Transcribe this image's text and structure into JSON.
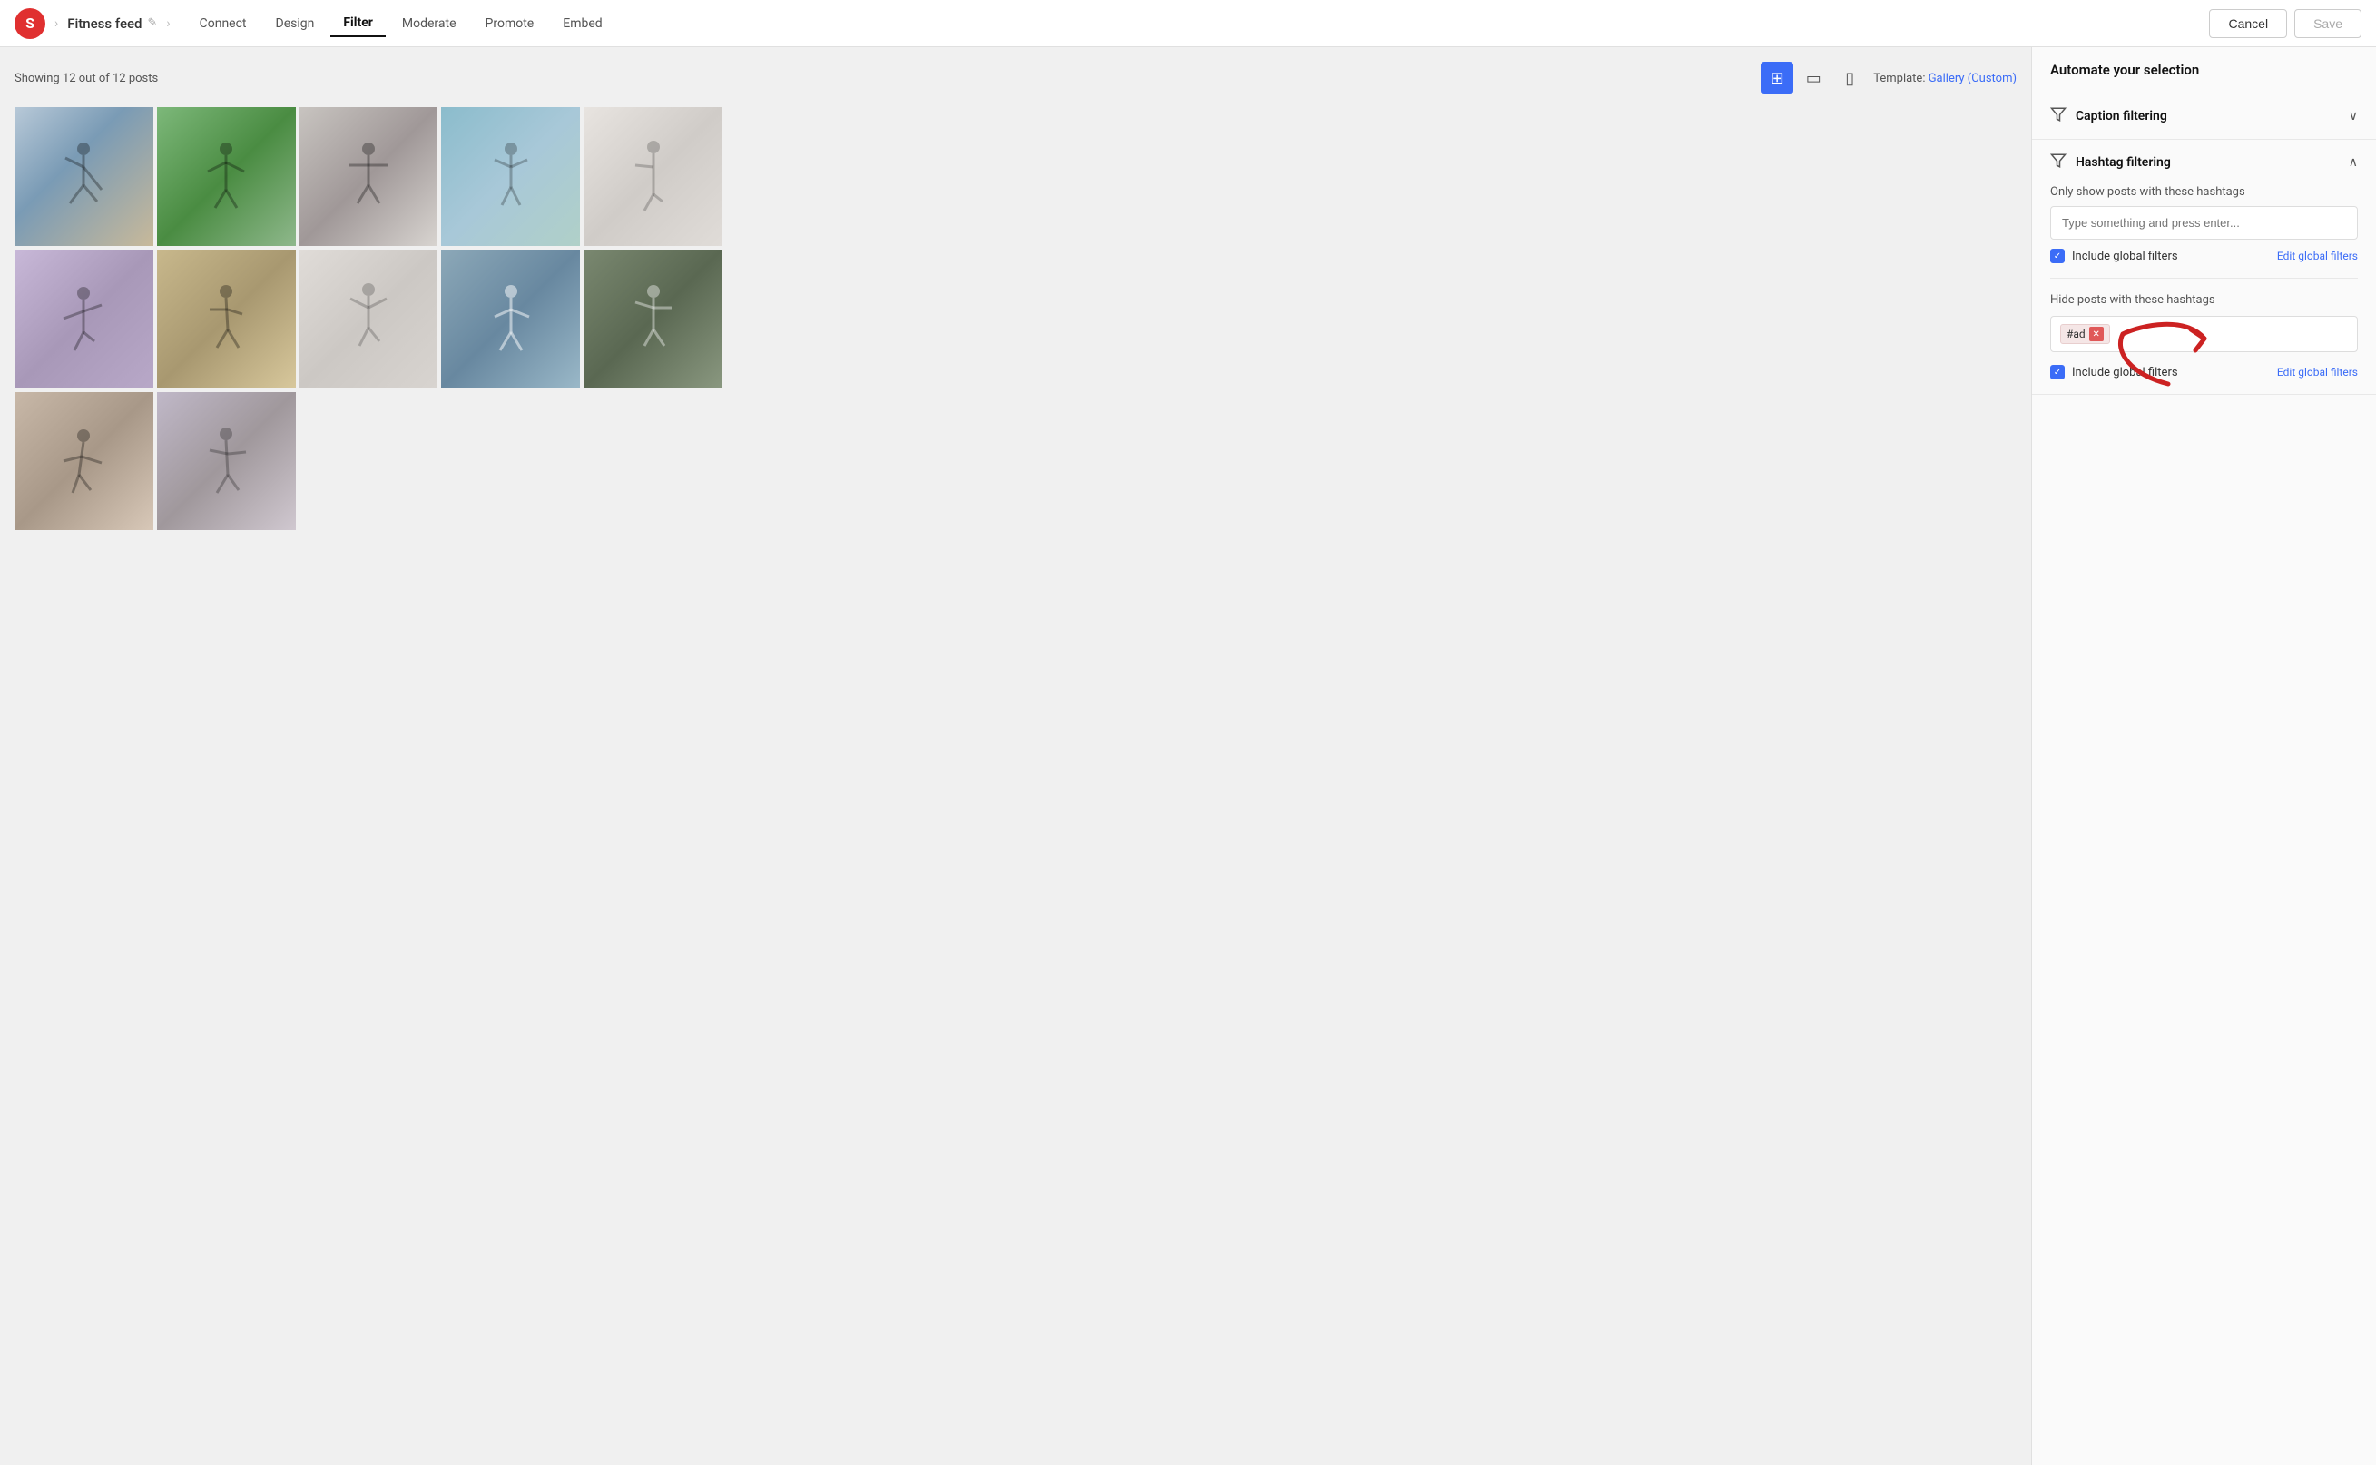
{
  "app": {
    "logo": "S",
    "logo_bg": "#e03030"
  },
  "breadcrumb": {
    "title": "Fitness feed",
    "edit_icon": "✏️"
  },
  "nav": {
    "tabs": [
      {
        "label": "Connect",
        "active": false
      },
      {
        "label": "Design",
        "active": false
      },
      {
        "label": "Filter",
        "active": true
      },
      {
        "label": "Moderate",
        "active": false
      },
      {
        "label": "Promote",
        "active": false
      },
      {
        "label": "Embed",
        "active": false
      }
    ],
    "cancel_label": "Cancel",
    "save_label": "Save"
  },
  "toolbar": {
    "posts_count": "Showing 12 out of 12 posts",
    "template_label": "Template:",
    "template_value": "Gallery (Custom)"
  },
  "right_panel": {
    "automate_header": "Automate your selection",
    "caption_filtering": {
      "title": "Caption filtering",
      "expanded": false
    },
    "hashtag_filtering": {
      "title": "Hashtag filtering",
      "expanded": true,
      "show_section_title": "Only show posts with these hashtags",
      "show_placeholder": "Type something and press enter...",
      "show_include_label": "Include global filters",
      "show_edit_label": "Edit global filters",
      "hide_section_title": "Hide posts with these hashtags",
      "hide_include_label": "Include global filters",
      "hide_edit_label": "Edit global filters",
      "hide_tag": "#ad"
    }
  }
}
